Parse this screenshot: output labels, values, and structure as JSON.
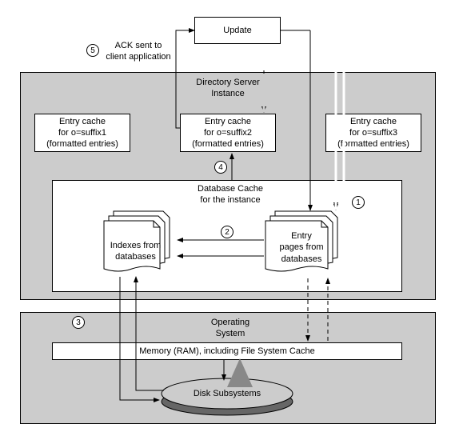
{
  "top": {
    "update_label": "Update",
    "ack_line1": "ACK sent to",
    "ack_line2": "client application"
  },
  "steps": {
    "s1": "1",
    "s2": "2",
    "s3": "3",
    "s4": "4",
    "s5": "5"
  },
  "dsi": {
    "title_line1": "Directory Server",
    "title_line2": "Instance",
    "ec1_l1": "Entry cache",
    "ec1_l2": "for o=suffix1",
    "ec1_l3": "(formatted entries)",
    "ec2_l1": "Entry cache",
    "ec2_l2": "for o=suffix2",
    "ec2_l3": "(formatted entries)",
    "ec3_l1": "Entry cache",
    "ec3_l2": "for o=suffix3",
    "ec3_l3": "(formatted entries)",
    "dbcache_l1": "Database Cache",
    "dbcache_l2": "for the instance",
    "idx_l1": "Indexes from",
    "idx_l2": "databases",
    "entry_l1": "Entry",
    "entry_l2": "pages from",
    "entry_l3": "databases"
  },
  "os": {
    "title_l1": "Operating",
    "title_l2": "System",
    "ram": "Memory (RAM), including File System Cache",
    "disk": "Disk Subsystems"
  }
}
